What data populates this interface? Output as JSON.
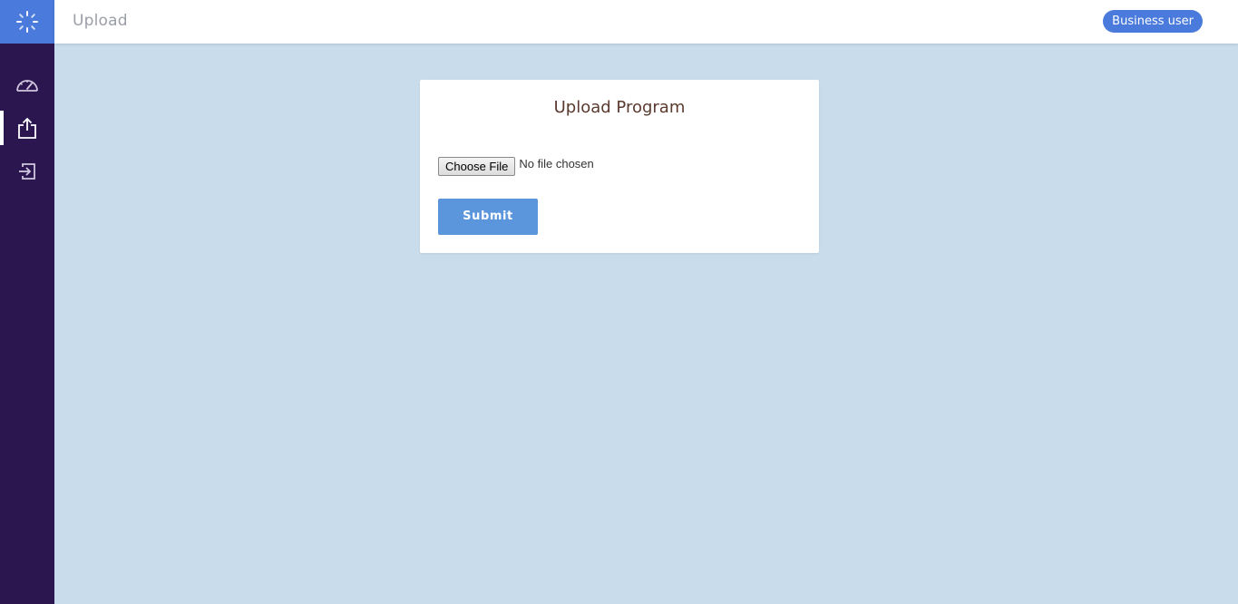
{
  "header": {
    "title": "Upload",
    "user_badge": "Business user"
  },
  "sidebar": {
    "logo_icon": "spinner-logo-icon",
    "items": [
      {
        "icon": "dashboard-gauge-icon",
        "active": false
      },
      {
        "icon": "upload-icon",
        "active": true
      },
      {
        "icon": "sign-in-icon",
        "active": false
      }
    ]
  },
  "upload_form": {
    "title": "Upload Program",
    "choose_file_label": "Choose File",
    "file_status": "No file chosen",
    "submit_label": "Submit"
  },
  "colors": {
    "sidebar": "#2b1650",
    "accent": "#4a7bdc",
    "background": "#c8dcec",
    "submit": "#5b95dc"
  }
}
